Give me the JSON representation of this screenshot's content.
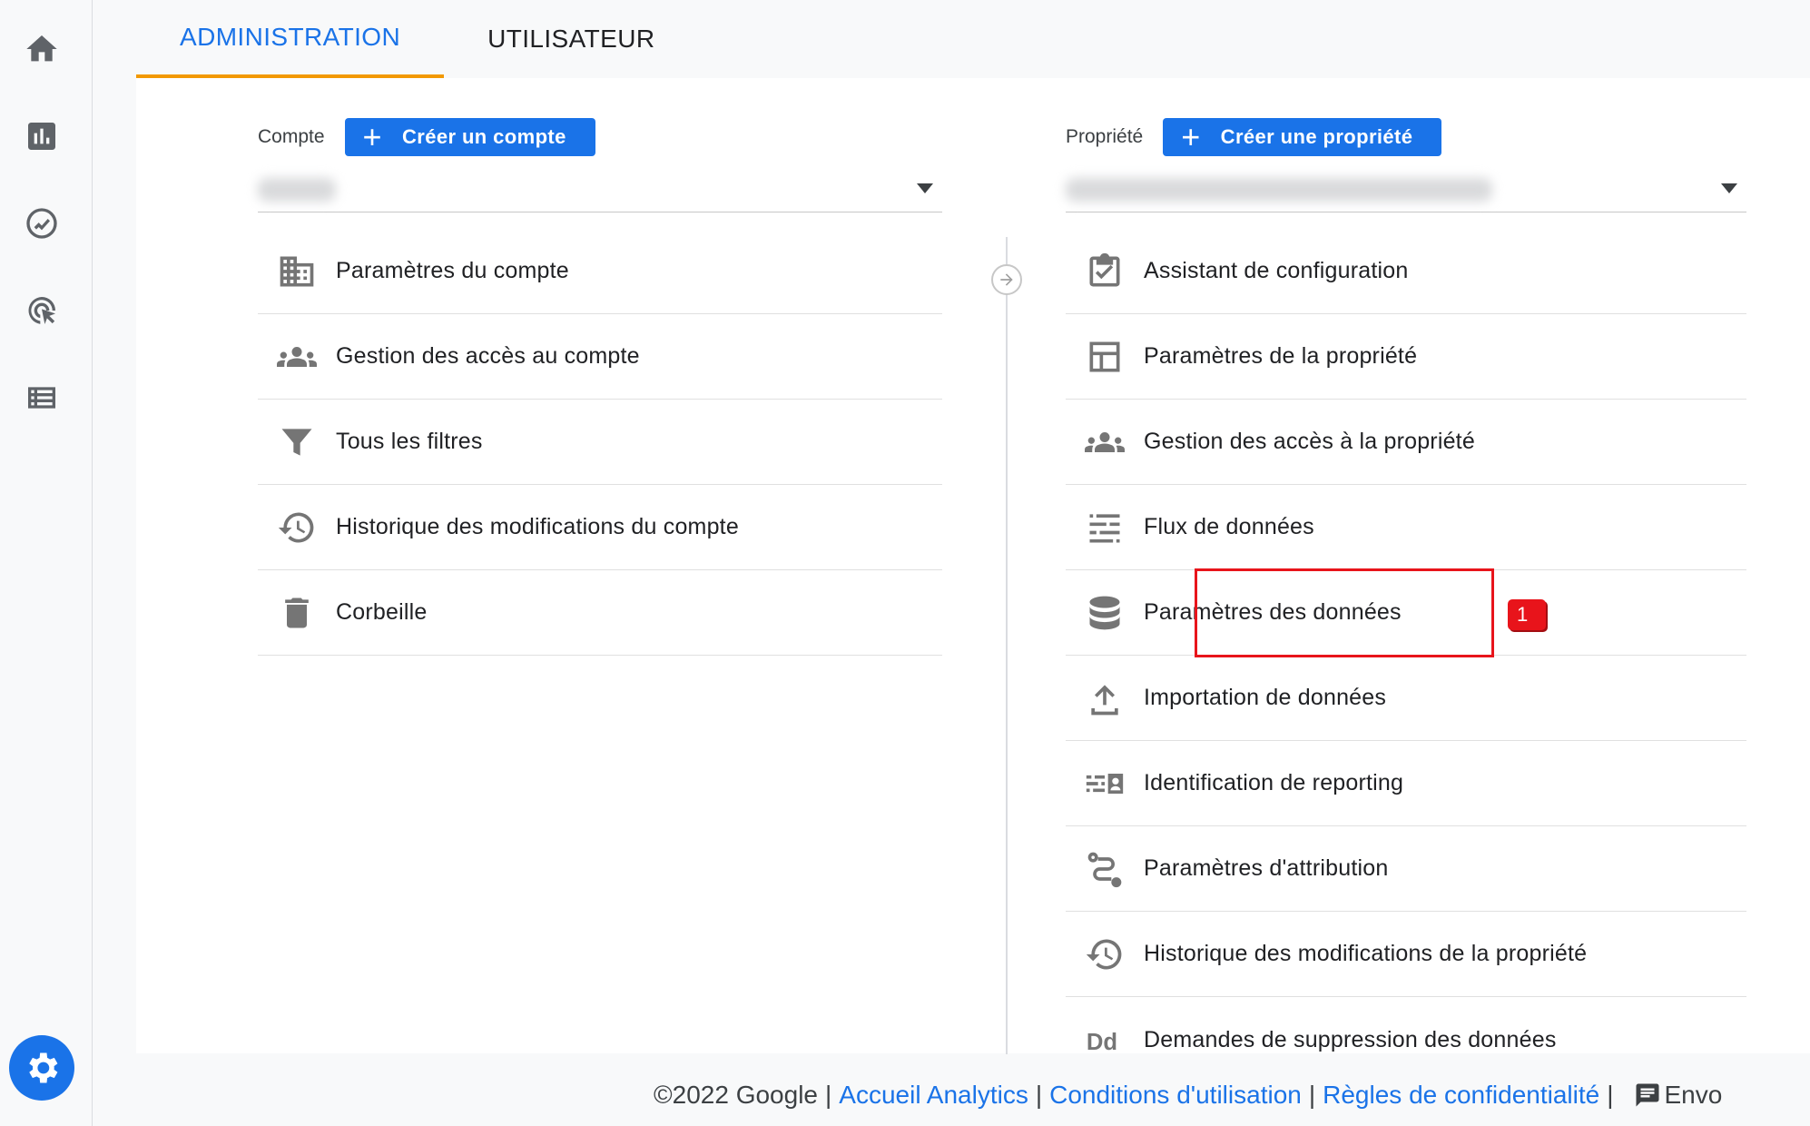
{
  "rail": {
    "icons": [
      "home-icon",
      "reports-icon",
      "explore-icon",
      "advertising-icon",
      "configure-icon"
    ],
    "settings_icon": "gear-icon"
  },
  "tabs": [
    {
      "label": "ADMINISTRATION",
      "active": true
    },
    {
      "label": "UTILISATEUR",
      "active": false
    }
  ],
  "account": {
    "label": "Compte",
    "create_label": "Créer un compte",
    "items": [
      {
        "icon": "building-icon",
        "label": "Paramètres du compte"
      },
      {
        "icon": "people-icon",
        "label": "Gestion des accès au compte"
      },
      {
        "icon": "filter-icon",
        "label": "Tous les filtres"
      },
      {
        "icon": "history-icon",
        "label": "Historique des modifications du compte"
      },
      {
        "icon": "trash-icon",
        "label": "Corbeille"
      }
    ]
  },
  "property": {
    "label": "Propriété",
    "create_label": "Créer une propriété",
    "items": [
      {
        "icon": "checklist-icon",
        "label": "Assistant de configuration"
      },
      {
        "icon": "layout-icon",
        "label": "Paramètres de la propriété"
      },
      {
        "icon": "people-icon",
        "label": "Gestion des accès à la propriété"
      },
      {
        "icon": "data-streams-icon",
        "label": "Flux de données"
      },
      {
        "icon": "database-icon",
        "label": "Paramètres des données"
      },
      {
        "icon": "upload-icon",
        "label": "Importation de données"
      },
      {
        "icon": "reporting-identity-icon",
        "label": "Identification de reporting"
      },
      {
        "icon": "attribution-icon",
        "label": "Paramètres d'attribution"
      },
      {
        "icon": "history-icon",
        "label": "Historique des modifications de la propriété"
      },
      {
        "icon": "dd-icon",
        "label": "Demandes de suppression des données"
      }
    ]
  },
  "annotation": {
    "badge": "1",
    "color": "#e8141b"
  },
  "footer": {
    "copyright": "©2022 Google",
    "links": [
      "Accueil Analytics",
      "Conditions d'utilisation",
      "Règles de confidentialité"
    ],
    "feedback": "Envo"
  },
  "colors": {
    "accent": "#1a73e8",
    "tab_indicator": "#f29900"
  }
}
